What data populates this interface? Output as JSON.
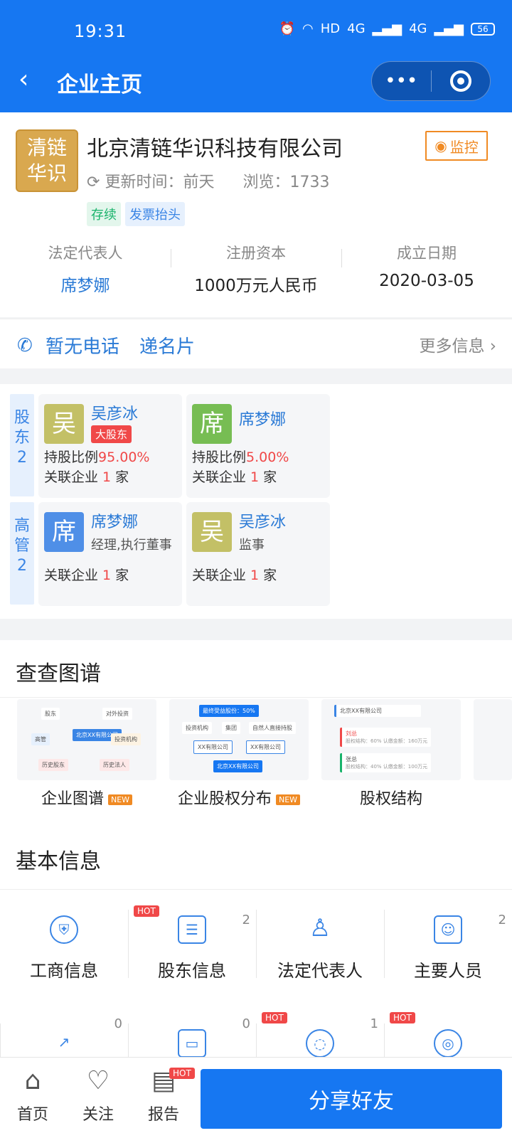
{
  "status": {
    "time": "19:31",
    "signal": "HD",
    "net1": "4G",
    "net2": "4G",
    "battery": "56"
  },
  "nav": {
    "back": "‹",
    "title": "企业主页",
    "more": "•••"
  },
  "company": {
    "logo_line1": "清链",
    "logo_line2": "华识",
    "name": "北京清链华识科技有限公司",
    "monitor_label": "监控",
    "updated": "更新时间：前天",
    "views": "浏览：1733",
    "tags": [
      "存续",
      "发票抬头"
    ],
    "facts": [
      {
        "label": "法定代表人",
        "value": "席梦娜"
      },
      {
        "label": "注册资本",
        "value": "1000万元人民币"
      },
      {
        "label": "成立日期",
        "value": "2020-03-05"
      }
    ]
  },
  "contact": {
    "phone": "暂无电话",
    "card": "递名片",
    "more": "更多信息 ›"
  },
  "shareholders": {
    "side": [
      "股",
      "东",
      "2"
    ],
    "items": [
      {
        "avatar": "吴",
        "name": "吴彦冰",
        "badge": "大股东",
        "ratio_label": "持股比例",
        "ratio": "95.00%",
        "rel_pre": "关联企业 ",
        "rel_num": "1",
        "rel_post": " 家"
      },
      {
        "avatar": "席",
        "name": "席梦娜",
        "ratio_label": "持股比例",
        "ratio": "5.00%",
        "rel_pre": "关联企业 ",
        "rel_num": "1",
        "rel_post": " 家"
      }
    ]
  },
  "executives": {
    "side": [
      "高",
      "管",
      "2"
    ],
    "items": [
      {
        "avatar": "席",
        "name": "席梦娜",
        "role": "经理,执行董事",
        "rel_pre": "关联企业 ",
        "rel_num": "1",
        "rel_post": " 家"
      },
      {
        "avatar": "吴",
        "name": "吴彦冰",
        "role": "监事",
        "rel_pre": "关联企业 ",
        "rel_num": "1",
        "rel_post": " 家"
      }
    ]
  },
  "graph": {
    "title": "查查图谱",
    "items": [
      {
        "label": "企业图谱",
        "badge": "NEW"
      },
      {
        "label": "企业股权分布",
        "badge": "NEW"
      },
      {
        "label": "股权结构"
      }
    ],
    "mini1": {
      "center": "北京XX有限公司",
      "nodes": [
        "股东",
        "对外投资",
        "高管",
        "投资机构",
        "历史股东",
        "历史法人"
      ]
    },
    "mini2": {
      "top": "最终受益股份：50%",
      "row": [
        "投资机构",
        "集团",
        "自然人直接持股"
      ],
      "mid": [
        "XX有限公司",
        "XX有限公司"
      ],
      "bottom": "北京XX有限公司"
    },
    "mini3": {
      "head": "北京XX有限公司",
      "p1": "刘总",
      "p1d": "股权结构：60%  认缴金额：160万元",
      "p2": "张总",
      "p2d": "股权结构：40%  认缴金额：100万元"
    }
  },
  "basic": {
    "title": "基本信息",
    "items": [
      {
        "label": "工商信息",
        "icon": "shield-icon"
      },
      {
        "label": "股东信息",
        "icon": "id-card-icon",
        "hot": "HOT",
        "count": "2"
      },
      {
        "label": "法定代表人",
        "icon": "person-icon"
      },
      {
        "label": "主要人员",
        "icon": "staff-icon",
        "count": "2"
      }
    ],
    "row2": [
      {
        "count": "0"
      },
      {
        "count": "0",
        "hot": "HOT"
      },
      {
        "count": "1",
        "hot": "HOT"
      },
      {}
    ]
  },
  "bottom": {
    "tabs": [
      {
        "label": "首页"
      },
      {
        "label": "关注"
      },
      {
        "label": "报告",
        "hot": "HOT"
      }
    ],
    "share": "分享好友"
  }
}
